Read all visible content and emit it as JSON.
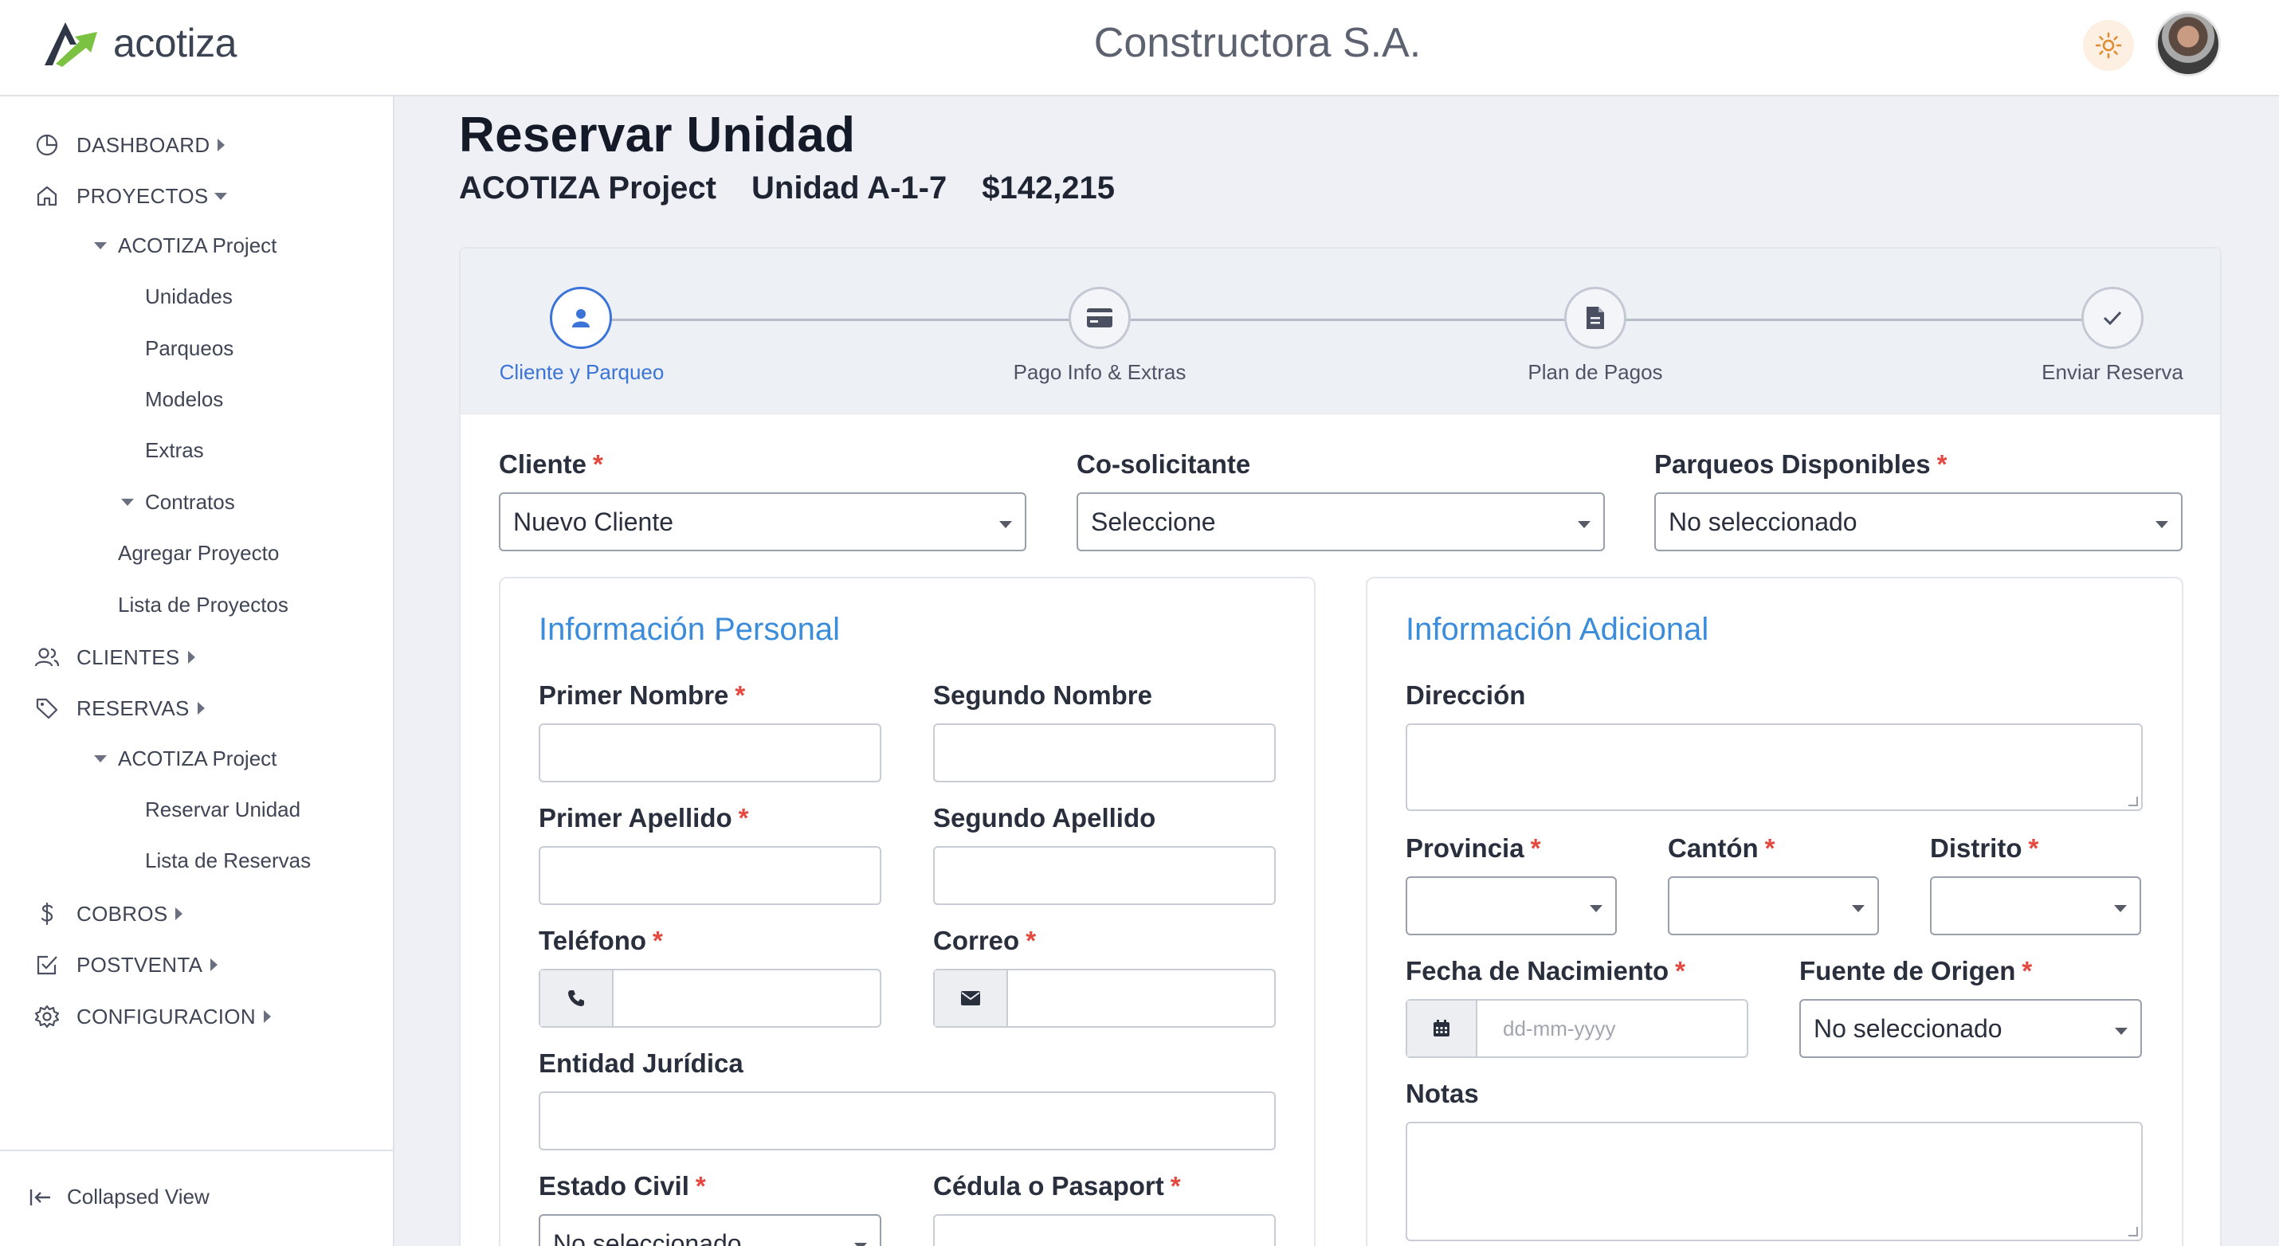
{
  "header": {
    "logo_text": "acotiza",
    "company": "Constructora S.A."
  },
  "sidebar": {
    "items": [
      {
        "label": "DASHBOARD"
      },
      {
        "label": "PROYECTOS"
      },
      {
        "label": "ACOTIZA Project"
      },
      {
        "label": "Unidades"
      },
      {
        "label": "Parqueos"
      },
      {
        "label": "Modelos"
      },
      {
        "label": "Extras"
      },
      {
        "label": "Contratos"
      },
      {
        "label": "Agregar Proyecto"
      },
      {
        "label": "Lista de Proyectos"
      },
      {
        "label": "CLIENTES"
      },
      {
        "label": "RESERVAS"
      },
      {
        "label": "ACOTIZA Project"
      },
      {
        "label": "Reservar Unidad"
      },
      {
        "label": "Lista de Reservas"
      },
      {
        "label": "COBROS"
      },
      {
        "label": "POSTVENTA"
      },
      {
        "label": "CONFIGURACION"
      }
    ],
    "collapse_label": "Collapsed View"
  },
  "main": {
    "title": "Reservar Unidad",
    "project": "ACOTIZA Project",
    "unit": "Unidad A-1-7",
    "price": "$142,215"
  },
  "stepper": {
    "steps": [
      {
        "label": "Cliente y Parqueo"
      },
      {
        "label": "Pago Info & Extras"
      },
      {
        "label": "Plan de Pagos"
      },
      {
        "label": "Enviar Reserva"
      }
    ],
    "active_index": 0
  },
  "form": {
    "cliente": {
      "label": "Cliente",
      "value": "Nuevo Cliente"
    },
    "cosolicitante": {
      "label": "Co-solicitante",
      "value": "Seleccione"
    },
    "parqueos": {
      "label": "Parqueos Disponibles",
      "value": "No seleccionado"
    },
    "required_mark": "*"
  },
  "personal": {
    "title": "Información Personal",
    "primer_nombre": "Primer Nombre",
    "segundo_nombre": "Segundo Nombre",
    "primer_apellido": "Primer Apellido",
    "segundo_apellido": "Segundo Apellido",
    "telefono": "Teléfono",
    "correo": "Correo",
    "entidad": "Entidad Jurídica",
    "estado_civil": {
      "label": "Estado Civil",
      "value": "No seleccionado"
    },
    "cedula": "Cédula o Pasaport"
  },
  "adicional": {
    "title": "Información Adicional",
    "direccion": "Dirección",
    "provincia": "Provincia",
    "canton": "Cantón",
    "distrito": "Distrito",
    "fecha": {
      "label": "Fecha de Nacimiento",
      "placeholder": "dd-mm-yyyy"
    },
    "fuente": {
      "label": "Fuente de Origen",
      "value": "No seleccionado"
    },
    "notas": "Notas"
  },
  "colors": {
    "accent": "#3b74d8",
    "panel_title": "#3b8ddc",
    "required": "#e5483f"
  }
}
